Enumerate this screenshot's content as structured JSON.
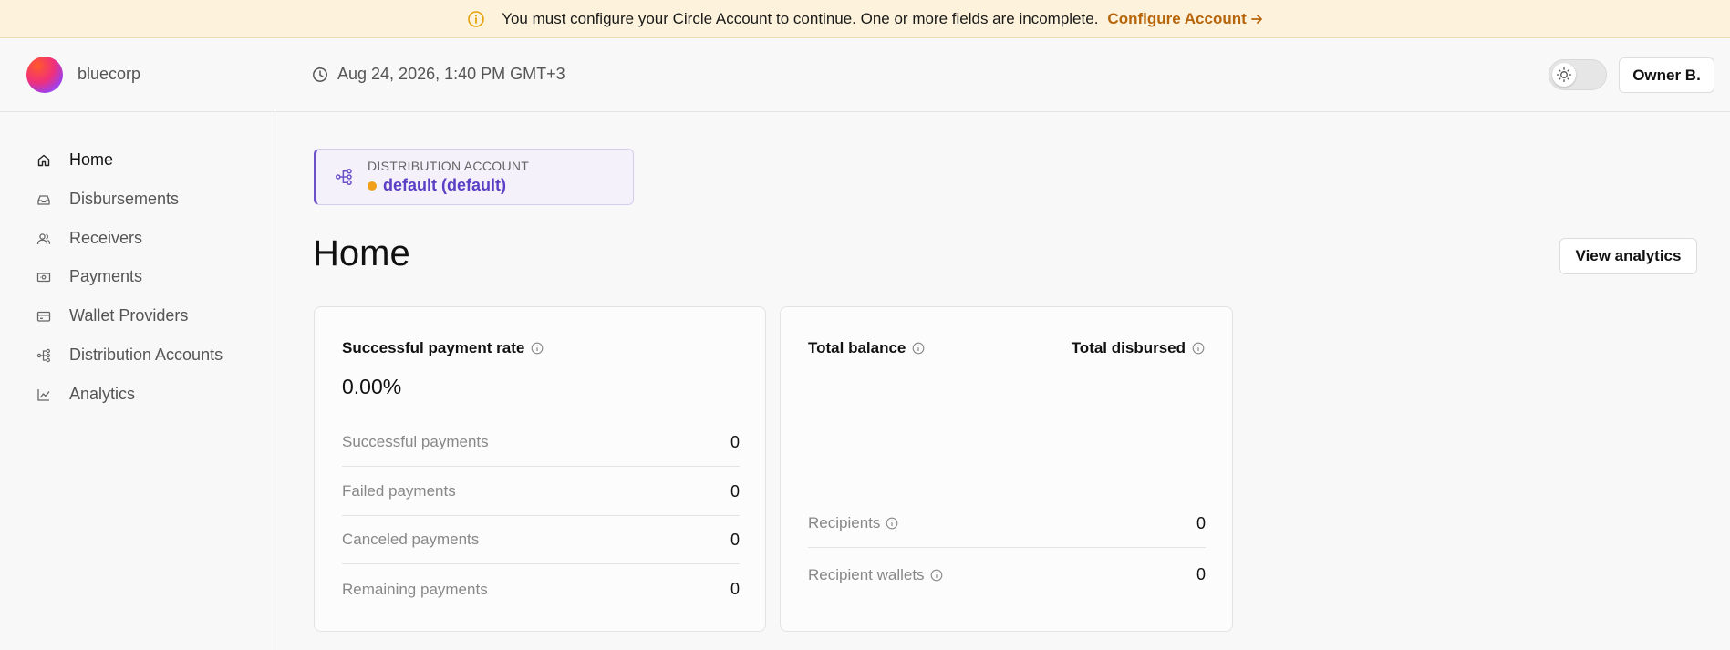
{
  "banner": {
    "message": "You must configure your Circle Account to continue. One or more fields are incomplete.",
    "link_label": "Configure Account"
  },
  "header": {
    "org_name": "bluecorp",
    "datetime": "Aug 24, 2026, 1:40 PM GMT+3",
    "user_label": "Owner B."
  },
  "sidebar": {
    "items": [
      {
        "label": "Home",
        "icon": "home-icon",
        "active": true
      },
      {
        "label": "Disbursements",
        "icon": "inbox-icon"
      },
      {
        "label": "Receivers",
        "icon": "users-icon"
      },
      {
        "label": "Payments",
        "icon": "banknote-icon"
      },
      {
        "label": "Wallet Providers",
        "icon": "wallet-icon"
      },
      {
        "label": "Distribution Accounts",
        "icon": "network-icon"
      },
      {
        "label": "Analytics",
        "icon": "line-chart-icon"
      }
    ]
  },
  "distribution": {
    "label": "DISTRIBUTION ACCOUNT",
    "value": "default (default)"
  },
  "page": {
    "title": "Home",
    "analytics_button": "View analytics"
  },
  "payment_card": {
    "title": "Successful payment rate",
    "rate": "0.00%",
    "rows": [
      {
        "label": "Successful payments",
        "value": "0"
      },
      {
        "label": "Failed payments",
        "value": "0"
      },
      {
        "label": "Canceled payments",
        "value": "0"
      },
      {
        "label": "Remaining payments",
        "value": "0"
      }
    ]
  },
  "balance_card": {
    "title_left": "Total balance",
    "title_right": "Total disbursed",
    "rows": [
      {
        "label": "Recipients",
        "value": "0"
      },
      {
        "label": "Recipient wallets",
        "value": "0"
      }
    ]
  },
  "colors": {
    "accent": "#5b3fc4",
    "warning": "#b7650a",
    "banner_bg": "#fdf3dc",
    "status_dot": "#f0a019"
  }
}
